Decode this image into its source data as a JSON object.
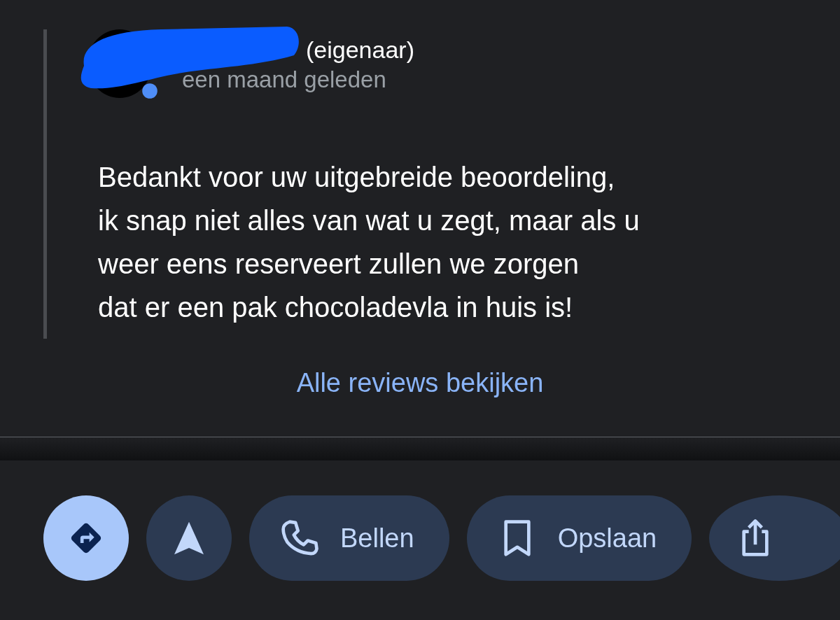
{
  "reply": {
    "role": "(eigenaar)",
    "time": "een maand geleden",
    "text": "Bedankt voor uw uitgebreide beoordeling,\nik snap niet alles van wat u zegt, maar als u\nweer eens reserveert zullen we zorgen\ndat er een pak chocoladevla in huis is!"
  },
  "all_reviews_link": "Alle reviews bekijken",
  "actions": [
    {
      "kind": "directions",
      "primary": true
    },
    {
      "kind": "navigate",
      "primary": false
    },
    {
      "kind": "call",
      "label": "Bellen",
      "primary": false
    },
    {
      "kind": "save",
      "label": "Opslaan",
      "primary": false
    },
    {
      "kind": "share",
      "primary": false
    }
  ]
}
